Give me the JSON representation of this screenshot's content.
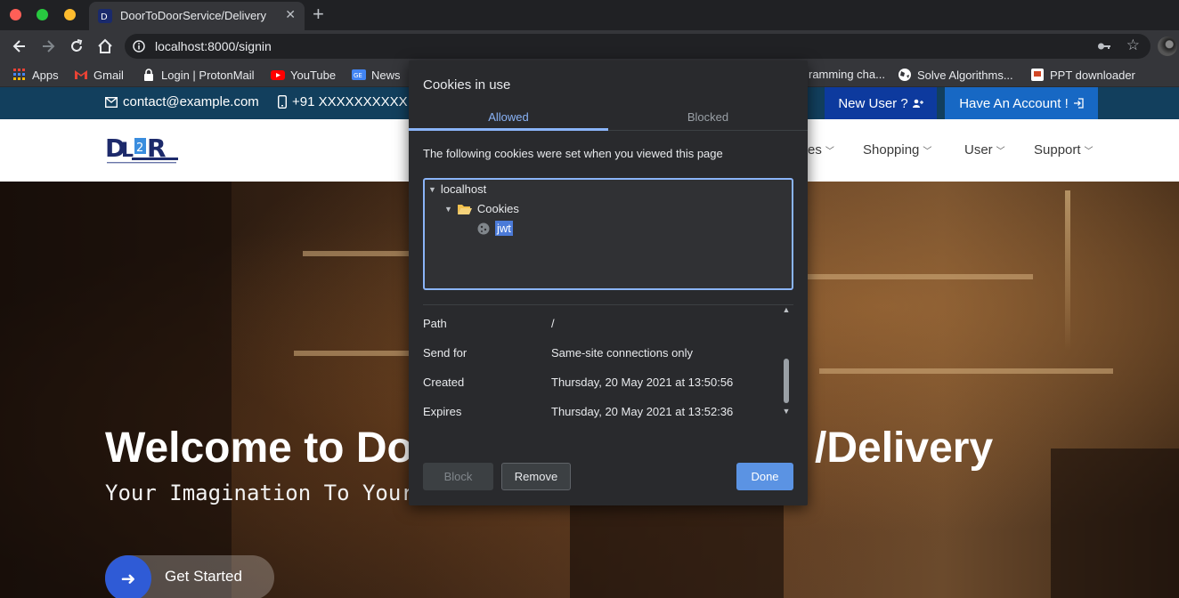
{
  "browser": {
    "tab_title": "DoorToDoorService/Delivery",
    "tab_close": "✕",
    "new_tab": "+",
    "url": "localhost:8000/signin"
  },
  "bookmarks": [
    {
      "label": "Apps",
      "icon": "apps-grid-icon",
      "color": "#e94235"
    },
    {
      "label": "Gmail",
      "icon": "gmail-icon",
      "color": "#ea4335"
    },
    {
      "label": "Login | ProtonMail",
      "icon": "protonmail-icon",
      "color": "#ffffff"
    },
    {
      "label": "YouTube",
      "icon": "youtube-icon",
      "color": "#ff0000"
    },
    {
      "label": "News",
      "icon": "google-news-icon",
      "color": "#4285f4"
    },
    {
      "label": "ramming cha...",
      "icon": "",
      "color": ""
    },
    {
      "label": "Solve Algorithms...",
      "icon": "globe-icon",
      "color": "#ffffff"
    },
    {
      "label": "PPT downloader",
      "icon": "ppt-icon",
      "color": "#d24726"
    }
  ],
  "site": {
    "email": "contact@example.com",
    "phone": "+91 XXXXXXXXXX",
    "new_user": "New User ?",
    "have_account": "Have An Account !",
    "nav": {
      "partial": "es",
      "shopping": "Shopping",
      "user": "User",
      "support": "Support"
    },
    "hero_title": "Welcome to Do",
    "hero_title_tail": "/Delivery",
    "hero_sub": "Your Imagination To Your",
    "get_started": "Get Started"
  },
  "dialog": {
    "title": "Cookies in use",
    "tabs": {
      "allowed": "Allowed",
      "blocked": "Blocked"
    },
    "description": "The following cookies were set when you viewed this page",
    "tree": {
      "host": "localhost",
      "folder": "Cookies",
      "cookie": "jwt"
    },
    "properties": [
      {
        "label": "Path",
        "value": "/"
      },
      {
        "label": "Send for",
        "value": "Same-site connections only"
      },
      {
        "label": "Created",
        "value": "Thursday, 20 May 2021 at 13:50:56"
      },
      {
        "label": "Expires",
        "value": "Thursday, 20 May 2021 at 13:52:36"
      }
    ],
    "buttons": {
      "block": "Block",
      "remove": "Remove",
      "done": "Done"
    }
  },
  "colors": {
    "accent": "#8ab4f8",
    "done_button": "#5b93e3",
    "topbar": "#123f5d",
    "new_user_bg": "#0d3a9e",
    "have_account_bg": "#1768c4",
    "get_started_circle": "#2f5bd6"
  }
}
